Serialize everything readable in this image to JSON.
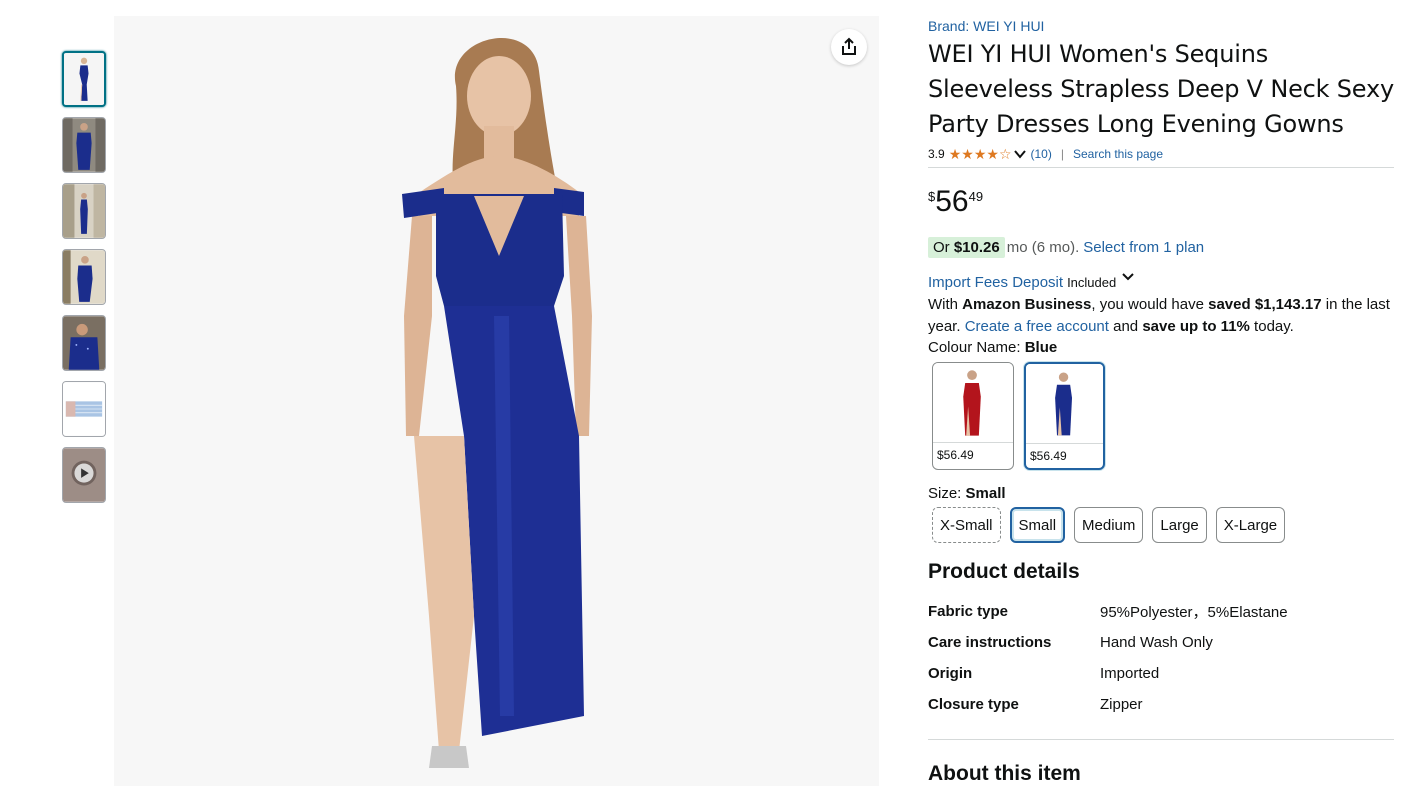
{
  "gallery": {
    "thumbnails": [
      {
        "kind": "image",
        "selected": true
      },
      {
        "kind": "image",
        "selected": false
      },
      {
        "kind": "image",
        "selected": false
      },
      {
        "kind": "image",
        "selected": false
      },
      {
        "kind": "image",
        "selected": false
      },
      {
        "kind": "size-chart",
        "selected": false
      },
      {
        "kind": "video",
        "selected": false
      }
    ],
    "share_icon": "share-icon",
    "dress_color": "#1b2d8c"
  },
  "product": {
    "brand": "Brand: WEI YI HUI",
    "title": "WEI YI HUI Women's Sequins Sleeveless Strapless Deep V Neck Sexy Party Dresses Long Evening Gowns",
    "rating": "3.9",
    "stars_value": 3.9,
    "review_count": "(10)",
    "search_link": "Search this page",
    "price": {
      "symbol": "$",
      "whole": "56",
      "fraction": "49"
    },
    "installment": {
      "prefix": "Or",
      "amount": "$10.26",
      "rest": "mo (6 mo).",
      "link": "Select from 1 plan"
    },
    "import_fees": {
      "link": "Import Fees Deposit",
      "status": "Included"
    },
    "business": {
      "t1": "With ",
      "b1": "Amazon Business",
      "t2": ", you would have ",
      "b2": "saved $1,143.17",
      "t3": " in the last year. ",
      "link": "Create a free account",
      "t4": " and ",
      "b3": "save up to 11%",
      "t5": " today."
    },
    "colour": {
      "label": "Colour Name: ",
      "selected": "Blue",
      "options": [
        {
          "name": "Red",
          "price": "$56.49",
          "color": "#b3141c",
          "selected": false
        },
        {
          "name": "Blue",
          "price": "$56.49",
          "color": "#1b2d8c",
          "selected": true
        }
      ]
    },
    "size": {
      "label": "Size: ",
      "selected": "Small",
      "options": [
        {
          "label": "X-Small",
          "state": "unavailable"
        },
        {
          "label": "Small",
          "state": "selected"
        },
        {
          "label": "Medium",
          "state": "normal"
        },
        {
          "label": "Large",
          "state": "normal"
        },
        {
          "label": "X-Large",
          "state": "normal"
        }
      ]
    },
    "details": {
      "title": "Product details",
      "rows": [
        {
          "key": "Fabric type",
          "value": "95%Polyester，5%Elastane"
        },
        {
          "key": "Care instructions",
          "value": "Hand Wash Only"
        },
        {
          "key": "Origin",
          "value": "Imported"
        },
        {
          "key": "Closure type",
          "value": "Zipper"
        }
      ]
    },
    "about_title": "About this item"
  },
  "colors": {
    "link": "#2162a1",
    "star": "#de7921",
    "selected_border": "#2162a1",
    "installment_bg": "#d7f0d9"
  }
}
